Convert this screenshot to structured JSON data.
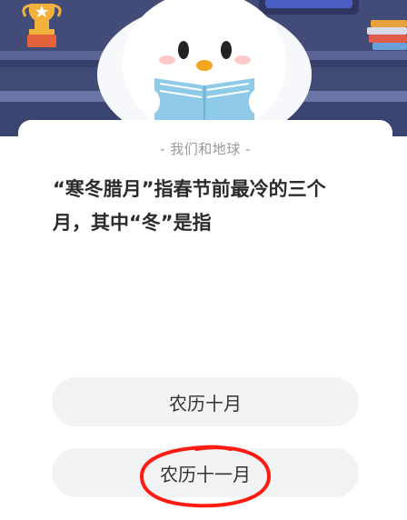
{
  "quiz": {
    "category": "- 我们和地球 -",
    "question": "“寒冬腊月”指春节前最冷的三个月，其中“冬”是指",
    "options": [
      {
        "label": "农历十月"
      },
      {
        "label": "农历十一月"
      }
    ]
  },
  "colors": {
    "hero_bg": "#3f4a75",
    "shelf": "#6b74a6",
    "card_bg": "#ffffff",
    "option_bg": "#f2f3f5",
    "book": "#8fcbe9",
    "trophy": "#f1b23b",
    "annotation_red": "#ff1a12"
  },
  "icons": {
    "trophy": "trophy-icon",
    "books": "books-icon",
    "mascot": "penguin-mascot-icon"
  }
}
